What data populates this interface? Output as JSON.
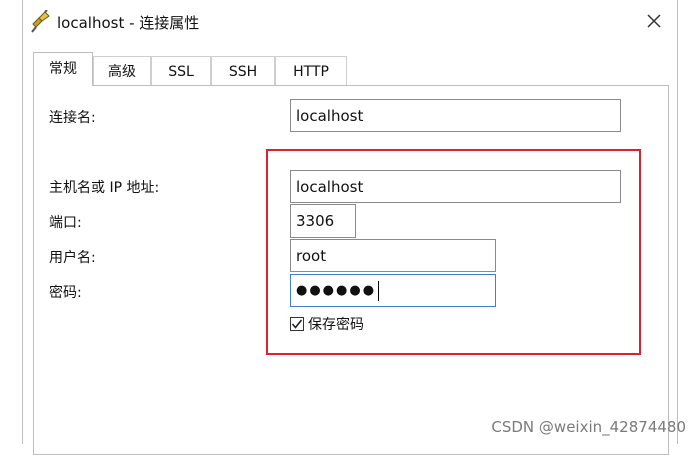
{
  "window": {
    "title": "localhost - 连接属性",
    "close_icon": "close-icon"
  },
  "tabs": [
    {
      "label": "常规",
      "active": true
    },
    {
      "label": "高级",
      "active": false
    },
    {
      "label": "SSL",
      "active": false
    },
    {
      "label": "SSH",
      "active": false
    },
    {
      "label": "HTTP",
      "active": false
    }
  ],
  "form": {
    "connection_name_label": "连接名:",
    "connection_name_value": "localhost",
    "host_label": "主机名或 IP 地址:",
    "host_value": "localhost",
    "port_label": "端口:",
    "port_value": "3306",
    "username_label": "用户名:",
    "username_value": "root",
    "password_label": "密码:",
    "password_masked": "●●●●●●",
    "save_password_label": "保存密码",
    "save_password_checked": true
  },
  "colors": {
    "highlight_border": "#d9242f",
    "focus_border": "#3c7fd3"
  },
  "watermark": "CSDN @weixin_42874480"
}
